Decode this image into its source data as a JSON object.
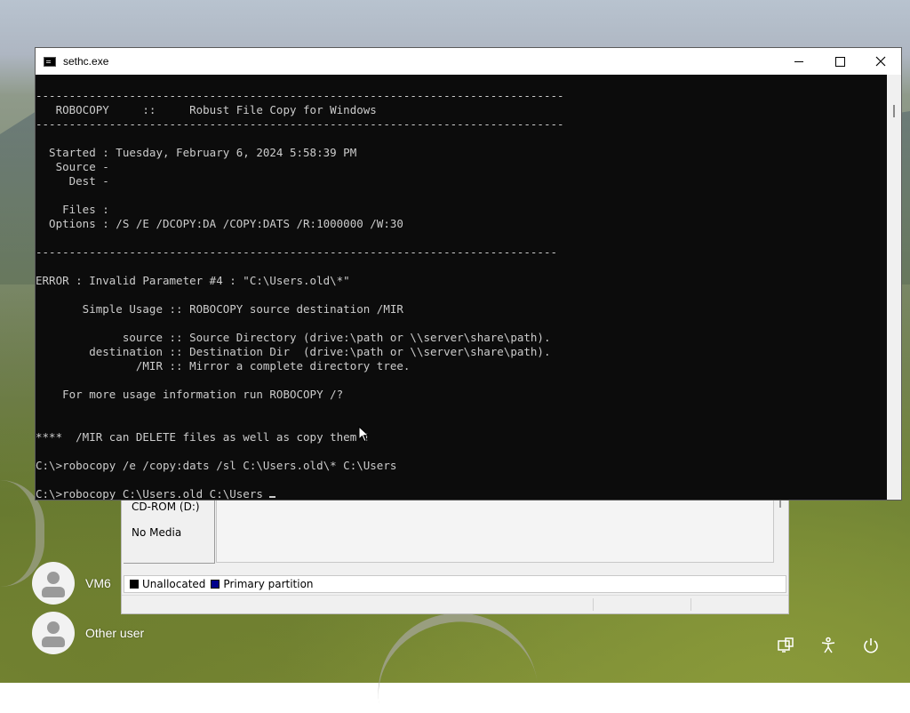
{
  "window": {
    "title": "sethc.exe",
    "minimize_label": "Minimize",
    "maximize_label": "Maximize",
    "close_label": "Close"
  },
  "console": {
    "lines": [
      "-------------------------------------------------------------------------------",
      "   ROBOCOPY     ::     Robust File Copy for Windows",
      "-------------------------------------------------------------------------------",
      "",
      "  Started : Tuesday, February 6, 2024 5:58:39 PM",
      "   Source -",
      "     Dest -",
      "",
      "    Files :",
      "  Options : /S /E /DCOPY:DA /COPY:DATS /R:1000000 /W:30",
      "",
      "------------------------------------------------------------------------------",
      "",
      "ERROR : Invalid Parameter #4 : \"C:\\Users.old\\*\"",
      "",
      "       Simple Usage :: ROBOCOPY source destination /MIR",
      "",
      "             source :: Source Directory (drive:\\path or \\\\server\\share\\path).",
      "        destination :: Destination Dir  (drive:\\path or \\\\server\\share\\path).",
      "               /MIR :: Mirror a complete directory tree.",
      "",
      "    For more usage information run ROBOCOPY /?",
      "",
      "",
      "****  /MIR can DELETE files as well as copy them !",
      "",
      "C:\\>robocopy /e /copy:dats /sl C:\\Users.old\\* C:\\Users",
      "",
      "C:\\>robocopy C:\\Users.old C:\\Users "
    ]
  },
  "disk_management": {
    "disk_name": "CD-ROM (D:)",
    "disk_status": "No Media",
    "legend": {
      "unallocated": "Unallocated",
      "primary": "Primary partition"
    },
    "colors": {
      "unallocated": "#000000",
      "primary": "#00008b"
    }
  },
  "users": [
    {
      "name": "VM6"
    },
    {
      "name": "Other user"
    }
  ],
  "system_icons": [
    "network-icon",
    "accessibility-icon",
    "power-icon"
  ]
}
